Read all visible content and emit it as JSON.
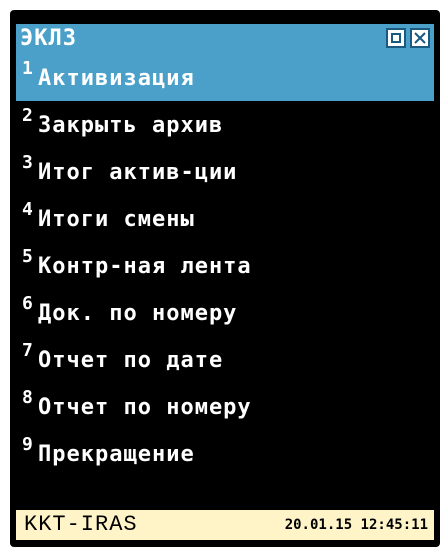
{
  "window": {
    "title": "ЭКЛЗ",
    "options_icon": "options-icon",
    "close_icon": "close-icon"
  },
  "menu": {
    "items": [
      {
        "num": "1",
        "label": "Активизация",
        "selected": true
      },
      {
        "num": "2",
        "label": "Закрыть архив"
      },
      {
        "num": "3",
        "label": "Итог актив-ции"
      },
      {
        "num": "4",
        "label": "Итоги смены"
      },
      {
        "num": "5",
        "label": "Контр-ная лента"
      },
      {
        "num": "6",
        "label": "Док. по номеру"
      },
      {
        "num": "7",
        "label": "Отчет по дате"
      },
      {
        "num": "8",
        "label": "Отчет по номеру"
      },
      {
        "num": "9",
        "label": "Прекращение"
      }
    ]
  },
  "status": {
    "device": "KKT-IRAS",
    "datetime": "20.01.15 12:45:11"
  },
  "colors": {
    "selection": "#4aa0c8",
    "background": "#000000",
    "status_bg": "#fff4c8"
  }
}
